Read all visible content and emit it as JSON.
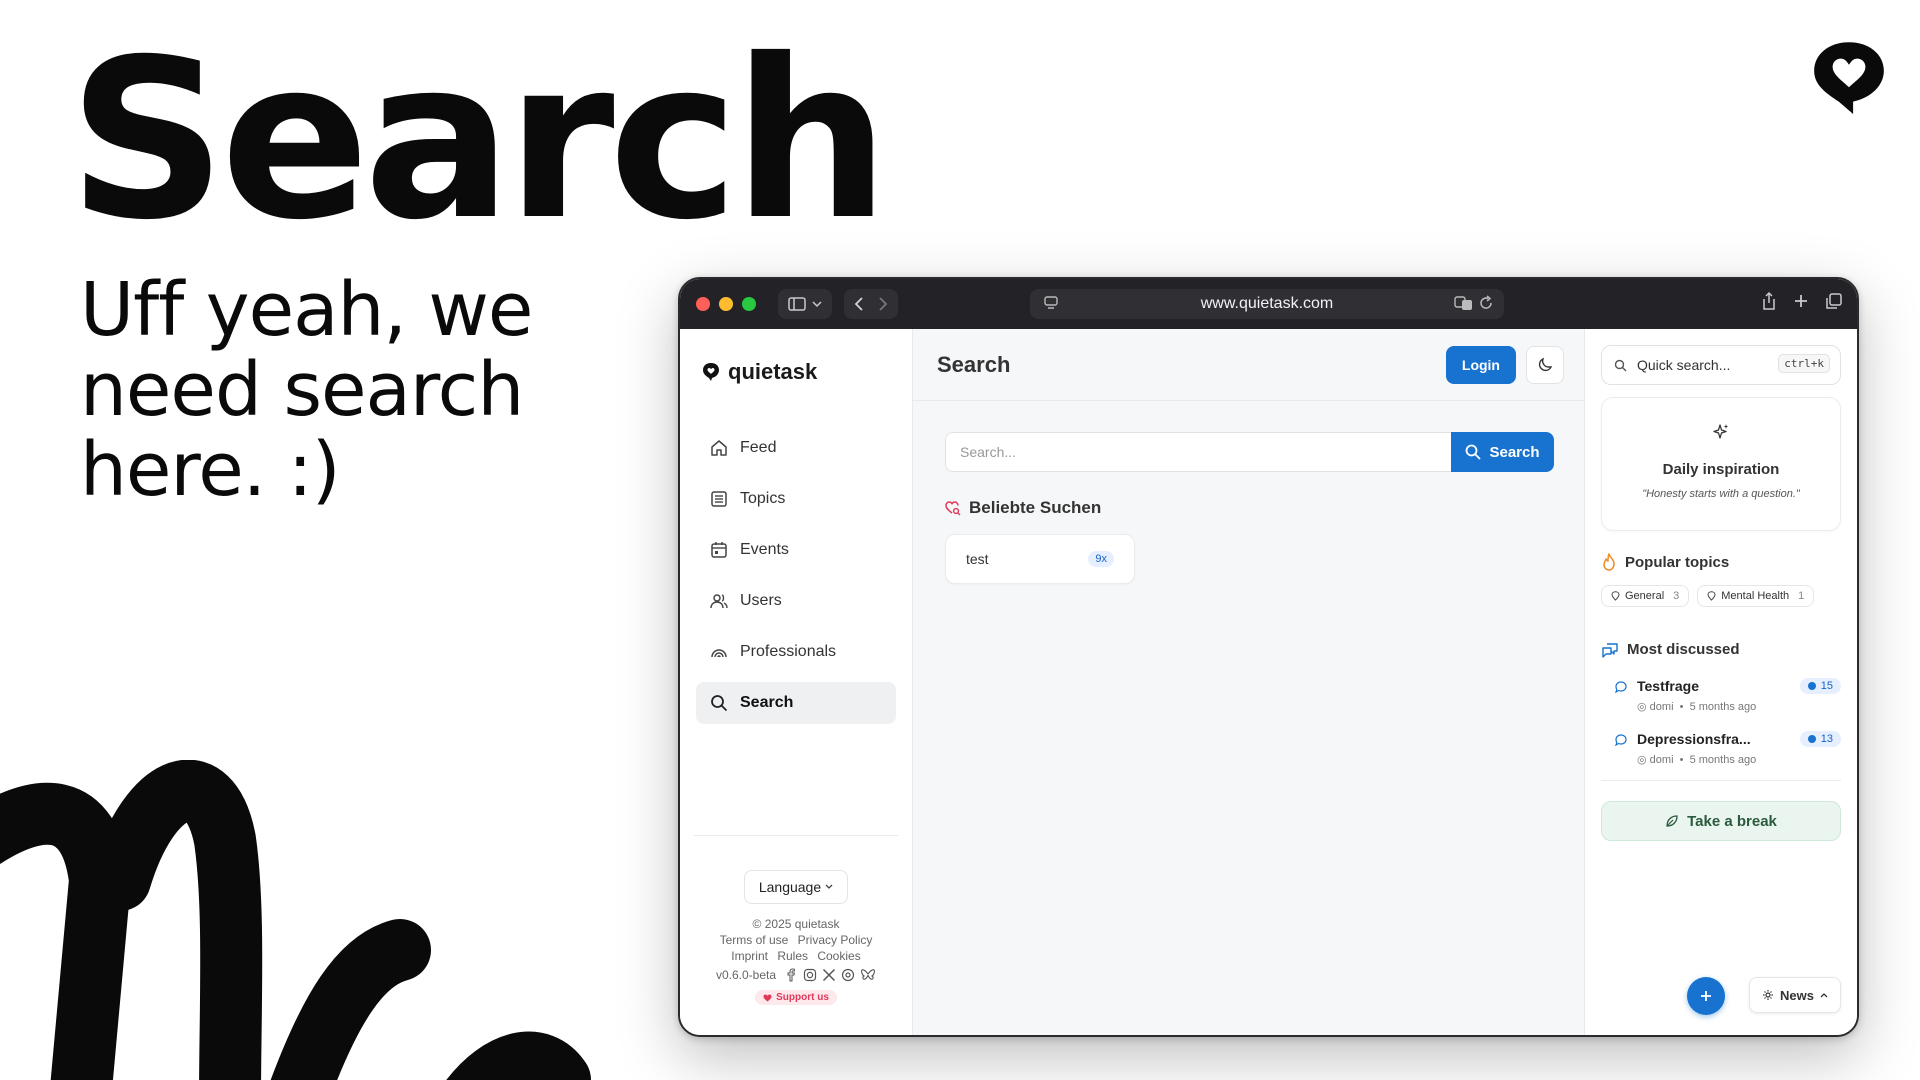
{
  "hero": {
    "title": "Search",
    "subtitle": "Uff yeah, we need search here. :)"
  },
  "browser": {
    "url": "www.quietask.com"
  },
  "app": {
    "brand": "quietask",
    "page_title": "Search",
    "login_label": "Login",
    "accent_color": "#1772d0"
  },
  "sidebar": {
    "items": [
      {
        "label": "Feed",
        "icon": "home-icon"
      },
      {
        "label": "Topics",
        "icon": "list-icon"
      },
      {
        "label": "Events",
        "icon": "calendar-icon"
      },
      {
        "label": "Users",
        "icon": "users-icon"
      },
      {
        "label": "Professionals",
        "icon": "signal-icon"
      },
      {
        "label": "Search",
        "icon": "search-icon",
        "active": true
      }
    ],
    "footer": {
      "language": "Language",
      "copyright": "© 2025 quietask",
      "links_row1": [
        "Terms of use",
        "Privacy Policy"
      ],
      "links_row2": [
        "Imprint",
        "Rules",
        "Cookies"
      ],
      "version": "v0.6.0-beta",
      "support": "Support us"
    }
  },
  "search": {
    "placeholder": "Search...",
    "button": "Search",
    "popular_heading": "Beliebte Suchen",
    "popular": [
      {
        "term": "test",
        "count": "9x"
      }
    ]
  },
  "right": {
    "quick_search": "Quick search...",
    "shortcut": "ctrl+k",
    "inspiration_title": "Daily inspiration",
    "inspiration_quote": "\"Honesty starts with a question.\"",
    "popular_topics_heading": "Popular topics",
    "topics": [
      {
        "name": "General",
        "count": "3"
      },
      {
        "name": "Mental Health",
        "count": "1"
      }
    ],
    "most_discussed_heading": "Most discussed",
    "discussed": [
      {
        "title": "Testfrage",
        "count": "15",
        "author": "domi",
        "time": "5 months ago"
      },
      {
        "title": "Depressionsfra...",
        "count": "13",
        "author": "domi",
        "time": "5 months ago"
      }
    ],
    "break_label": "Take a break",
    "news_label": "News"
  }
}
